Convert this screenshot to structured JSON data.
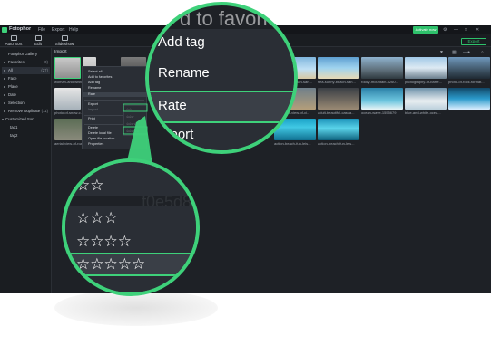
{
  "app": {
    "name": "Fotophor"
  },
  "menu": [
    "File",
    "Export",
    "Help"
  ],
  "activate_label": "Activate now",
  "toolbar": {
    "auto_sort": "Auto Sort",
    "edit": "Edit",
    "slideshow": "Slideshow",
    "export": "Export"
  },
  "sidebar": {
    "items": [
      {
        "label": "Fotophor Gallery",
        "count": ""
      },
      {
        "label": "Favorites",
        "count": "(0)"
      },
      {
        "label": "All",
        "count": "(27)"
      },
      {
        "label": "Face",
        "count": ""
      },
      {
        "label": "Place",
        "count": ""
      },
      {
        "label": "Date",
        "count": ""
      },
      {
        "label": "Selection",
        "count": ""
      },
      {
        "label": "Remove Duplicate",
        "count": "(11)"
      },
      {
        "label": "Customized Sort",
        "count": ""
      },
      {
        "label": "tag1",
        "count": ""
      },
      {
        "label": "tag2",
        "count": ""
      }
    ]
  },
  "breadcrumb": "Import",
  "captions": {
    "row1": [
      "woman-and-white-...",
      "20061...",
      "...",
      "...",
      "sea-sunny-beach-san...",
      "sea-sunny-beach-san...",
      "rocky-mountain-3260...",
      "photography-of-barre...",
      "photo-of-rock-format..."
    ],
    "row2": [
      "photo-of-snow-c...",
      "...",
      "...",
      "...",
      "...",
      "bird-s-eye-view-of-ci...",
      "adult-beautiful-casua...",
      "ocean-wave-1555679",
      "blue-and-white-ocea..."
    ],
    "row3": [
      "aerial-view-of-road-...",
      "aerial-photo-...",
      "...",
      "...",
      "action-beach-fun-leis...",
      "action-beach-fun-leis..."
    ]
  },
  "context_menu": {
    "items": [
      "Select all",
      "Add to favorites",
      "Add tag",
      "Rename",
      "Rate",
      "Export",
      "Import",
      "Print",
      "Delete",
      "Delete local file",
      "Open file location",
      "Properties"
    ]
  },
  "zoom1": {
    "partial_top": "d to favorit",
    "items": [
      "Add tag",
      "Rename",
      "Rate",
      "xport"
    ],
    "bg_text": "te-buil",
    "selected": "Rate"
  },
  "zoom2": {
    "bg_text": "f0e5d83",
    "ratings": [
      "☆☆",
      "☆☆☆",
      "☆☆☆☆",
      "☆☆☆☆☆"
    ],
    "selected": "☆☆☆☆☆"
  },
  "colors": {
    "accent": "#3ed17a",
    "bg": "#1e2126",
    "panel": "#1a1d21"
  }
}
